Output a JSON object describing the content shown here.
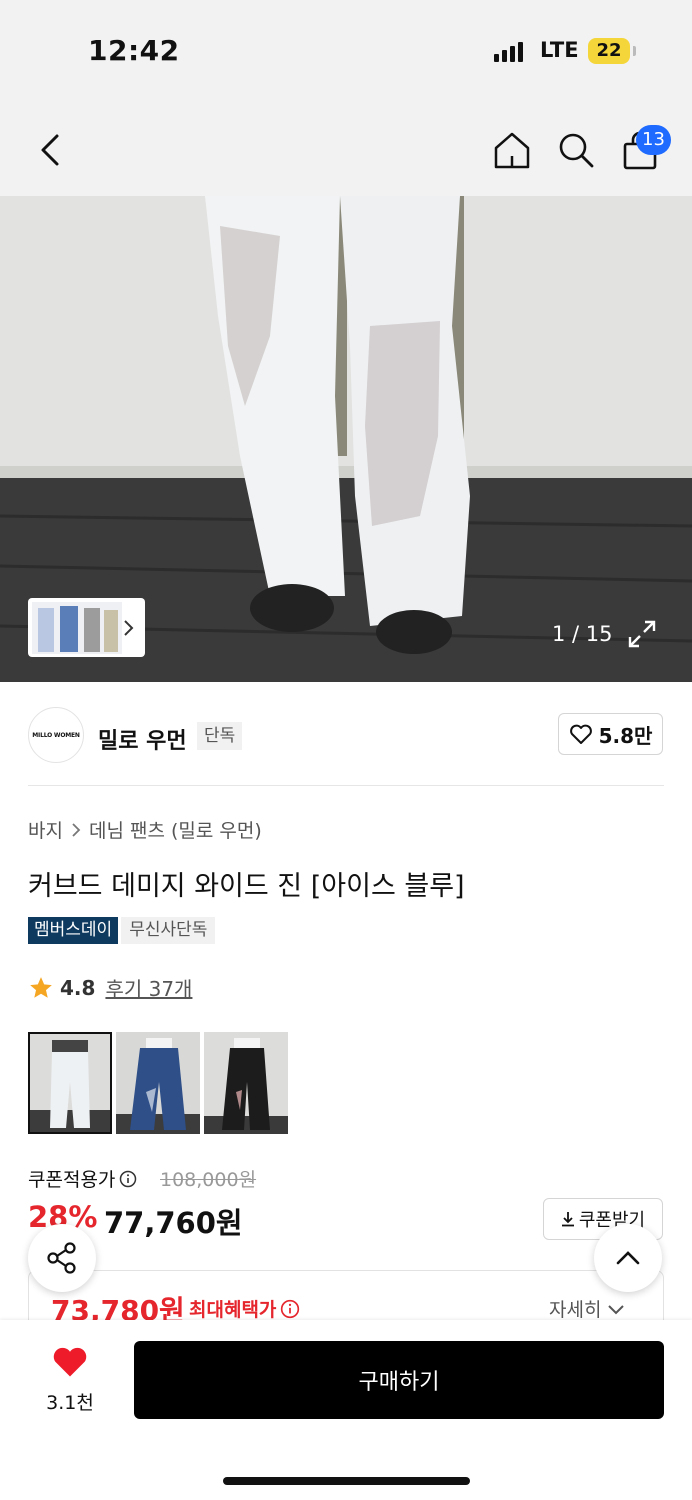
{
  "status_bar": {
    "time": "12:42",
    "network": "LTE",
    "battery": "22"
  },
  "nav": {
    "cart_count": "13"
  },
  "gallery": {
    "counter": "1 / 15"
  },
  "brand": {
    "logo_text": "MILLO WOMEN",
    "name": "밀로 우먼",
    "tag": "단독",
    "likes": "5.8만"
  },
  "product": {
    "breadcrumb": [
      "바지",
      "데님 팬츠 (밀로 우먼)"
    ],
    "title": "커브드 데미지 와이드 진 [아이스 블루]",
    "badges": [
      "멤버스데이",
      "무신사단독"
    ],
    "rating": "4.8",
    "review_link": "후기 37개"
  },
  "price": {
    "coupon_label": "쿠폰적용가",
    "original": "108,000원",
    "discount_rate": "28%",
    "sale": "77,760원",
    "coupon_button": "쿠폰받기",
    "max_benefit_price": "73,780원",
    "max_benefit_label": "최대혜택가",
    "detail_label": "자세히"
  },
  "bottom": {
    "wish_count": "3.1천",
    "buy_label": "구매하기"
  },
  "colors": {
    "accent_red": "#e5262d",
    "badge_blue": "#0d3a5e",
    "cart_badge": "#1f6bff"
  }
}
